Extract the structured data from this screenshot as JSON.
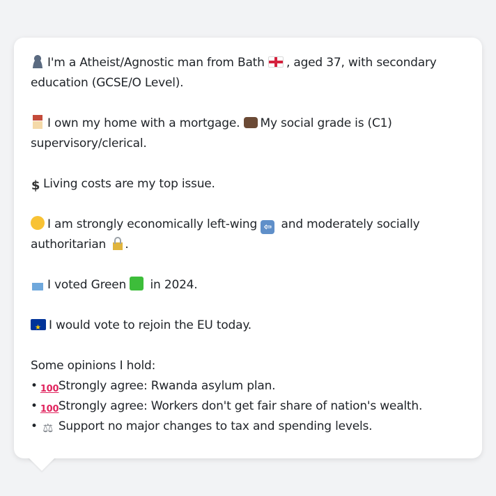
{
  "profile": {
    "intro": {
      "icon": "person-icon",
      "text_before_flag": "I'm a Atheist/Agnostic man from Bath",
      "flag_icon": "england-flag-icon",
      "text_after_flag": ", aged 37, with secondary",
      "line2": "education (GCSE/O Level)."
    },
    "housing": {
      "house_icon": "house-icon",
      "text1": "I own my home with a mortgage.",
      "briefcase_icon": "briefcase-icon",
      "text2": "My social grade is (C1)",
      "line2": "supervisory/clerical."
    },
    "issue": {
      "icon": "dollar-icon",
      "text": "Living costs are my top issue."
    },
    "politics": {
      "icon": "thinking-face-icon",
      "text1": "I am strongly economically left-wing",
      "arrow_icon": "left-arrow-icon",
      "text2": "and moderately socially",
      "line2": "authoritarian",
      "lock_icon": "lock-icon",
      "line2_end": "."
    },
    "vote": {
      "icon": "ballot-box-icon",
      "text1": "I voted Green",
      "green_icon": "green-square-icon",
      "text2": "in 2024."
    },
    "eu": {
      "icon": "eu-flag-icon",
      "text": "I would vote to rejoin the EU today."
    },
    "opinions": {
      "heading": "Some opinions I hold:",
      "items": [
        {
          "bullet": "•",
          "icon": "hundred-points-icon",
          "text": "Strongly agree: Rwanda asylum plan."
        },
        {
          "bullet": "•",
          "icon": "hundred-points-icon",
          "text": "Strongly agree: Workers don't get fair share of nation's wealth."
        },
        {
          "bullet": "•",
          "icon": "balance-scale-icon",
          "text": "Support no major changes to tax and spending levels."
        }
      ]
    }
  },
  "colors": {
    "background": "#f2f3f5",
    "card": "#ffffff",
    "text": "#1f2328"
  }
}
